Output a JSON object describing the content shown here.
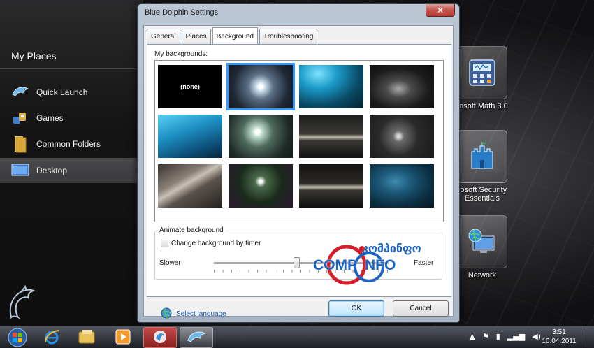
{
  "dock": {
    "title": "My Places",
    "items": [
      {
        "label": "Quick Launch",
        "icon": "dolphin-icon"
      },
      {
        "label": "Games",
        "icon": "games-icon"
      },
      {
        "label": "Common Folders",
        "icon": "folder-icon"
      },
      {
        "label": "Desktop",
        "icon": "desktop-icon",
        "selected": true
      }
    ]
  },
  "desktop_icons": [
    {
      "label": "rosoft Math 3.0",
      "icon": "calculator-icon"
    },
    {
      "label": "rosoft Security Essentials",
      "line1": "rosoft Security",
      "line2": "Essentials",
      "icon": "castle-icon"
    },
    {
      "label": "Network",
      "icon": "network-icon"
    }
  ],
  "dialog": {
    "title": "Blue Dolphin Settings",
    "close_glyph": "✕",
    "tabs": [
      {
        "label": "General"
      },
      {
        "label": "Places"
      },
      {
        "label": "Background",
        "active": true
      },
      {
        "label": "Troubleshooting"
      }
    ],
    "backgrounds_label": "My backgrounds:",
    "none_label": "(none)",
    "selected_index": 1,
    "animate_group": "Animate background",
    "timer_checkbox": {
      "label": "Change background by timer",
      "checked": false
    },
    "slider": {
      "min_label": "Slower",
      "max_label": "Faster",
      "value": 0.47
    },
    "select_language": "Select language",
    "ok_label": "OK",
    "cancel_label": "Cancel"
  },
  "watermark": {
    "georgian": "კომპინფო",
    "left": "COMP",
    "right": "NFO"
  },
  "taskbar": {
    "time": "3:51",
    "date": "10.04.2011"
  }
}
